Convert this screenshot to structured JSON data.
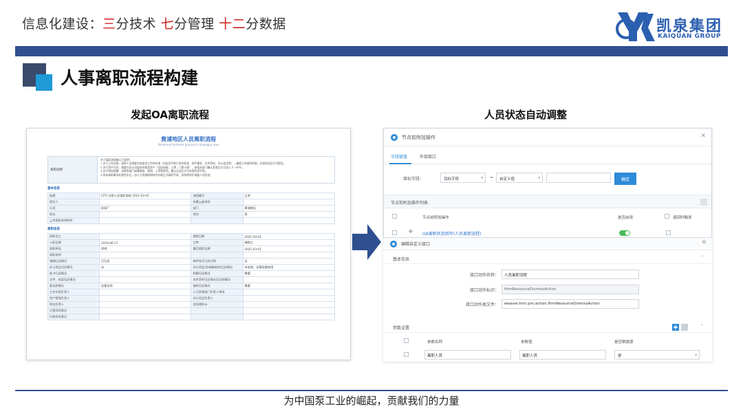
{
  "header": {
    "title_prefix": "信息化建设：",
    "part1_num": "三",
    "part1_text": "分技术",
    "part2_num": "七",
    "part2_text": "分管理",
    "part3_num": "十二",
    "part3_text": "分数据",
    "logo_cn": "凯泉集团",
    "logo_en": "KAIQUAN GROUP"
  },
  "section_title": "人事离职流程构建",
  "left_caption": "发起OA离职流程",
  "right_caption": "人员状态自动调整",
  "form": {
    "title": "黄浦地区人员离职流程",
    "subtitle": "Personnel turnover process in Huangpu area",
    "reason_label": "离职说明",
    "reason_lines": [
      "关于离职流程做以下说明：",
      "1.关于工作交接：离职人员需要完成各项工作的交接（包括但不限于岗位职责、经手事务、文件资料、办公用品等），确保工作顺利衔接，交接完成后方可提交。",
      "2.关于资产归还：需要归还公司配发的各类资产（包括电脑、工牌、门禁卡等），由相关部门确认签收后方可进入下一环节。",
      "3.关于财务结算：由财务部门核算借款、报销、工资等款项，确认无误后方可办理后续手续。",
      "4.所有离职事项处理完毕后，由人力资源部审核并办理正式离职手续，系统将同步调整人员状态。"
    ],
    "section_basic": "基本信息",
    "section_detail": "离职信息",
    "basic_rows": [
      {
        "l1": "标题",
        "v1": "[OT] 在职人员离职流程 2021-03-01",
        "l2": "流程编号",
        "v2": "正常"
      },
      {
        "l1": "提交人",
        "v1": "",
        "l2": "所属上级领导",
        "v2": ""
      },
      {
        "l1": "公司",
        "v1": "凯泉厂",
        "l2": "部门",
        "v2": "黄浦地区"
      },
      {
        "l1": "岗位",
        "v1": "",
        "l2": "性别",
        "v2": "男"
      },
      {
        "l1": "上传离职说明附件",
        "v1": "",
        "l2": "",
        "v2": ""
      }
    ],
    "detail_rows": [
      {
        "l1": "离职员工",
        "v1": "",
        "l2": "提报日期",
        "v2": "2021-03-01"
      },
      {
        "l1": "入职日期",
        "v1": "2019-06-17",
        "l2": "工种",
        "v2": "辅助工"
      },
      {
        "l1": "离职原因",
        "v1": "其他",
        "l2": "最后离职日期",
        "v2": "2021-03-01"
      },
      {
        "l1": "离职说明",
        "v1": "",
        "l2": "",
        "v2": ""
      },
      {
        "l1": "电脑归还情况",
        "v1": "已归还",
        "l2": "邮件账号已经注销",
        "v2": "无"
      },
      {
        "l1": "办公用品归还情况",
        "v1": "无",
        "l2": "办公用品(含电脑耗材)归还情况",
        "v2": "未处理，无需设备借用"
      },
      {
        "l1": "饭卡归还情况",
        "v1": "",
        "l2": "制服归还情况",
        "v2": "需要"
      },
      {
        "l1": "文件、档案归还情况",
        "v1": "",
        "l2": "技术资料归还情况及归档情况",
        "v2": ""
      },
      {
        "l1": "暂支款情况",
        "v1": "无暂支款",
        "l2": "借款归还情况",
        "v2": "需要"
      },
      {
        "l1": "工作交接负责人",
        "v1": "",
        "l2": "人力资源部门负责人审批",
        "v2": ""
      },
      {
        "l1": "资产管理负责人",
        "v1": "",
        "l2": "办公用品负责人",
        "v2": ""
      },
      {
        "l1": "财务负责人",
        "v1": "",
        "l2": "总经理批示",
        "v2": ""
      },
      {
        "l1": "分管领导意见",
        "v1": "",
        "l2": "",
        "v2": ""
      },
      {
        "l1": "行政领导意见",
        "v1": "",
        "l2": "",
        "v2": ""
      }
    ]
  },
  "dialog1": {
    "title": "节点前附加操作",
    "tab_field": "字段赋值",
    "tab_api": "外部接口",
    "target_label": "目标字段：",
    "target_select": "目标字段",
    "equals": "=",
    "value_select": "自定义值",
    "confirm_label": "确定",
    "list_title": "节点前附加操作列表",
    "col_action": "节点前附加操作",
    "col_enabled": "是否启用",
    "col_return": "退回时触发",
    "row_link": "OA离职状态回写(人员离职流程)"
  },
  "dialog2": {
    "title": "编辑自定义接口",
    "basic_section": "基本信息",
    "name_label": "接口动作名称：",
    "name_value": "人员离职流程",
    "id_label": "接口动作标识：",
    "id_value": "HrmResourceDismissAction",
    "class_label": "接口动作类文件：",
    "class_value": "weaver.hrm.pm.action.HrmResourceDismissAction",
    "param_section": "参数设置",
    "col_param_name": "参数名称",
    "col_param_value": "参数值",
    "col_is_db": "是否数据源",
    "param_name": "离职人员",
    "param_value": "离职人员",
    "is_db": "是"
  },
  "footer": "为中国泵工业的崛起，贡献我们的力量",
  "colors": {
    "accent_blue": "#2f4f8f",
    "highlight_red": "#d42020",
    "brand_blue": "#2b5fb0",
    "oa_blue": "#2e8bd8"
  }
}
